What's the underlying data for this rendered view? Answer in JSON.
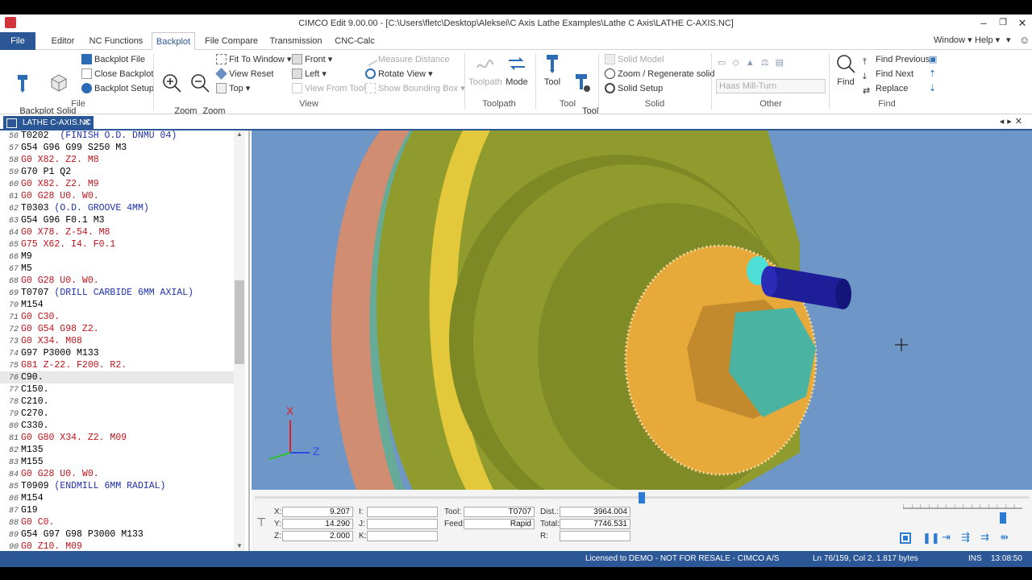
{
  "window": {
    "title": "CIMCO Edit 9.00.00 - [C:\\Users\\fletc\\Desktop\\Aleksei\\C Axis Lathe Examples\\Lathe C Axis\\LATHE C-AXIS.NC]"
  },
  "menu": {
    "tabs": [
      "File",
      "Editor",
      "NC Functions",
      "Backplot",
      "File Compare",
      "Transmission",
      "CNC-Calc"
    ],
    "active": "Backplot",
    "right": {
      "window": "Window",
      "help": "Help"
    }
  },
  "ribbon": {
    "file_group": {
      "label": "File",
      "backplot_window": "Backplot\nWindow",
      "solid_animation": "Solid\nAnimation",
      "backplot_file": "Backplot File",
      "close_backplot": "Close Backplot",
      "backplot_setup": "Backplot Setup"
    },
    "view_group": {
      "label": "View",
      "zoom_in": "Zoom\nIn",
      "zoom_out": "Zoom\nOut",
      "fit_to_window": "Fit To Window",
      "view_reset": "View Reset",
      "top": "Top",
      "front": "Front",
      "left": "Left",
      "view_from_tool": "View From Tool",
      "measure_distance": "Measure Distance",
      "rotate_view": "Rotate View",
      "show_bounding_box": "Show Bounding Box"
    },
    "toolpath_group": {
      "label": "Toolpath",
      "toolpath": "Toolpath",
      "mode": "Mode"
    },
    "tool_group": {
      "label": "Tool",
      "tool": "Tool",
      "tool_setup": "Tool\nSetup"
    },
    "solid_group": {
      "label": "Solid",
      "solid_model": "Solid Model",
      "zoom_regenerate": "Zoom / Regenerate solid",
      "solid_setup": "Solid Setup"
    },
    "other_group": {
      "label": "Other",
      "machine_combo": "Haas Mill-Turn"
    },
    "find_group": {
      "label": "Find",
      "find": "Find",
      "find_previous": "Find Previous",
      "find_next": "Find Next",
      "replace": "Replace"
    }
  },
  "document_tab": {
    "label": "LATHE C-AXIS.NC"
  },
  "editor": {
    "current_line": 76,
    "lines": [
      {
        "n": "56",
        "t": "T0202 ",
        "c": " (FINISH O.D. DNMU 04)",
        "k": "black"
      },
      {
        "n": "57",
        "t": "G54 G96 G99 S250 M3",
        "k": "black"
      },
      {
        "n": "58",
        "t": "G0 X82. Z2. M8",
        "k": "red"
      },
      {
        "n": "59",
        "t": "G70 P1 Q2",
        "k": "black"
      },
      {
        "n": "60",
        "t": "G0 X82. Z2. M9",
        "k": "red"
      },
      {
        "n": "61",
        "t": "G0 G28 U0. W0.",
        "k": "red"
      },
      {
        "n": "62",
        "t": "T0303 ",
        "c": "(O.D. GROOVE 4MM)",
        "k": "black"
      },
      {
        "n": "63",
        "t": "G54 G96 F0.1 M3",
        "k": "black"
      },
      {
        "n": "64",
        "t": "G0 X78. Z-54. M8",
        "k": "red"
      },
      {
        "n": "65",
        "t": "G75 X62. I4. F0.1",
        "k": "red"
      },
      {
        "n": "66",
        "t": "M9",
        "k": "black"
      },
      {
        "n": "67",
        "t": "M5",
        "k": "black"
      },
      {
        "n": "68",
        "t": "G0 G28 U0. W0.",
        "k": "red"
      },
      {
        "n": "69",
        "t": "T0707 ",
        "c": "(DRILL CARBIDE 6MM AXIAL)",
        "k": "black"
      },
      {
        "n": "70",
        "t": "M154",
        "k": "black"
      },
      {
        "n": "71",
        "t": "G0 C30.",
        "k": "red"
      },
      {
        "n": "72",
        "t": "G0 G54 G98 Z2.",
        "k": "red"
      },
      {
        "n": "73",
        "t": "G0 X34. M08",
        "k": "red"
      },
      {
        "n": "74",
        "t": "G97 P3000 M133",
        "k": "black"
      },
      {
        "n": "75",
        "t": "G81 Z-22. F200. R2.",
        "k": "red"
      },
      {
        "n": "76",
        "t": "C90.",
        "k": "black"
      },
      {
        "n": "77",
        "t": "C150.",
        "k": "black"
      },
      {
        "n": "78",
        "t": "C210.",
        "k": "black"
      },
      {
        "n": "79",
        "t": "C270.",
        "k": "black"
      },
      {
        "n": "80",
        "t": "C330.",
        "k": "black"
      },
      {
        "n": "81",
        "t": "G0 G80 X34. Z2. M09",
        "k": "red"
      },
      {
        "n": "82",
        "t": "M135",
        "k": "black"
      },
      {
        "n": "83",
        "t": "M155",
        "k": "black"
      },
      {
        "n": "84",
        "t": "G0 G28 U0. W0.",
        "k": "red"
      },
      {
        "n": "85",
        "t": "T0909 ",
        "c": "(ENDMILL 6MM RADIAL)",
        "k": "black"
      },
      {
        "n": "86",
        "t": "M154",
        "k": "black"
      },
      {
        "n": "87",
        "t": "G19",
        "k": "black"
      },
      {
        "n": "88",
        "t": "G0 C0.",
        "k": "red"
      },
      {
        "n": "89",
        "t": "G54 G97 G98 P3000 M133",
        "k": "black"
      },
      {
        "n": "90",
        "t": "G0 Z10. M09",
        "k": "red"
      }
    ]
  },
  "viewport": {
    "axis_x": "X",
    "axis_z": "Z",
    "background": "#6e96c6",
    "part_color": "#8f9b2c",
    "face_color": "#e7a93a",
    "groove_color": "#e2c83a",
    "chuck_color": "#d08d72",
    "hex_color": "#4bb3a1",
    "tool_color": "#1d1e98",
    "timeline_position": 0.5
  },
  "info_panel": {
    "x_label": "X:",
    "x": "9.207",
    "y_label": "Y:",
    "y": "14.290",
    "z_label": "Z:",
    "z": "2.000",
    "i_label": "I:",
    "j_label": "J:",
    "k_label": "K:",
    "tool_label": "Tool:",
    "tool": "T0707",
    "feed_label": "Feed:",
    "feed": "Rapid",
    "dist_label": "Dist.:",
    "dist": "3964.004",
    "total_label": "Total:",
    "total": "7746.531",
    "r_label": "R:",
    "speed_position": 0.84
  },
  "status_bar": {
    "license": "Licensed to DEMO - NOT FOR RESALE - CIMCO A/S",
    "position": "Ln 76/159, Col 2, 1.817 bytes",
    "mode": "INS",
    "time": "13:08:50"
  }
}
